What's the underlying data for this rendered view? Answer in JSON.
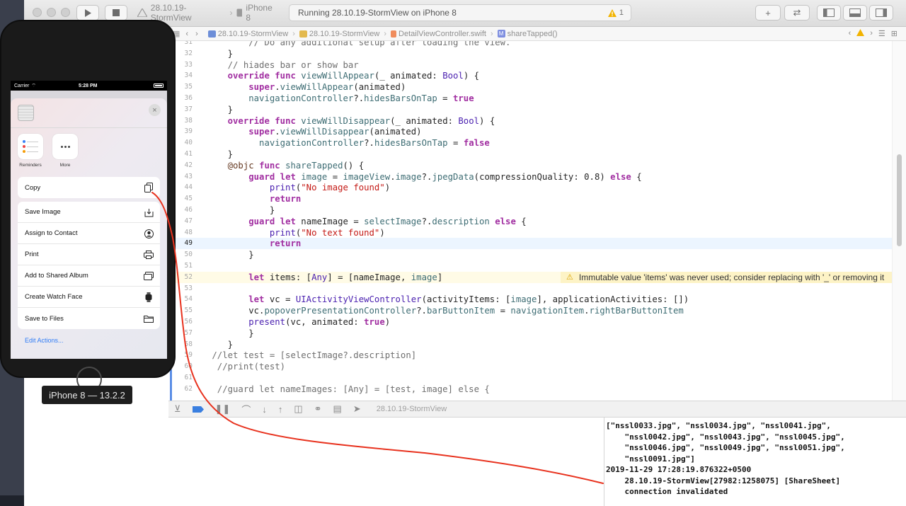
{
  "toolbar": {
    "scheme_name": "28.10.19-StormView",
    "device_name": "iPhone 8",
    "activity_text": "Running 28.10.19-StormView on iPhone 8",
    "warning_count": "1",
    "add_glyph": "+",
    "swap_glyph": "⇄"
  },
  "jumpbar": {
    "crumbs": [
      "28.10.19-StormView",
      "28.10.19-StormView",
      "DetailViewController.swift",
      "shareTapped()"
    ],
    "method_badge": "M"
  },
  "editor": {
    "lines": [
      {
        "n": "31",
        "code": "        // Do any additional setup after loading the view."
      },
      {
        "n": "32",
        "code": "    }"
      },
      {
        "n": "33",
        "code": "    // hiades bar or show bar"
      },
      {
        "n": "34",
        "code": "    override func viewWillAppear(_ animated: Bool) {"
      },
      {
        "n": "35",
        "code": "        super.viewWillAppear(animated)"
      },
      {
        "n": "36",
        "code": "        navigationController?.hidesBarsOnTap = true"
      },
      {
        "n": "37",
        "code": "    }"
      },
      {
        "n": "38",
        "code": "    override func viewWillDisappear(_ animated: Bool) {"
      },
      {
        "n": "39",
        "code": "        super.viewWillDisappear(animated)"
      },
      {
        "n": "40",
        "code": "          navigationController?.hidesBarsOnTap = false"
      },
      {
        "n": "41",
        "code": "    }"
      },
      {
        "n": "42",
        "code": "    @objc func shareTapped() {"
      },
      {
        "n": "43",
        "code": "        guard let image = imageView.image?.jpegData(compressionQuality: 0.8) else {"
      },
      {
        "n": "44",
        "code": "            print(\"No image found\")"
      },
      {
        "n": "45",
        "code": "            return"
      },
      {
        "n": "46",
        "code": "            }"
      },
      {
        "n": "47",
        "code": "        guard let nameImage = selectImage?.description else {"
      },
      {
        "n": "48",
        "code": "            print(\"No text found\")"
      },
      {
        "n": "49",
        "code": "            return"
      },
      {
        "n": "50",
        "code": "        }"
      },
      {
        "n": "51",
        "code": ""
      },
      {
        "n": "52",
        "code": "        let items: [Any] = [nameImage, image]"
      },
      {
        "n": "53",
        "code": ""
      },
      {
        "n": "54",
        "code": "        let vc = UIActivityViewController(activityItems: [image], applicationActivities: [])"
      },
      {
        "n": "55",
        "code": "        vc.popoverPresentationController?.barButtonItem = navigationItem.rightBarButtonItem"
      },
      {
        "n": "56",
        "code": "        present(vc, animated: true)"
      },
      {
        "n": "57",
        "code": "        }"
      },
      {
        "n": "58",
        "code": "    }"
      },
      {
        "n": "59",
        "code": " //let test = [selectImage?.description]"
      },
      {
        "n": "60",
        "code": "  //print(test)"
      },
      {
        "n": "61",
        "code": ""
      },
      {
        "n": "62",
        "code": "  //guard let nameImages: [Any] = [test, image] else {"
      }
    ],
    "current_line": "49",
    "warning_line": "52",
    "warning_message": "Immutable value 'items' was never used; consider replacing with '_' or removing it"
  },
  "debugbar": {
    "target_label": "28.10.19-StormView"
  },
  "console": {
    "lines": [
      "[\"nssl0033.jpg\", \"nssl0034.jpg\", \"nssl0041.jpg\",",
      "    \"nssl0042.jpg\", \"nssl0043.jpg\", \"nssl0045.jpg\",",
      "    \"nssl0046.jpg\", \"nssl0049.jpg\", \"nssl0051.jpg\",",
      "    \"nssl0091.jpg\"]",
      "2019-11-29 17:28:19.876322+0500",
      "    28.10.19-StormView[27982:1258075] [ShareSheet]",
      "    connection invalidated"
    ]
  },
  "simulator": {
    "carrier": "Carrier",
    "time": "5:28 PM",
    "close_glyph": "×",
    "apps": [
      {
        "label": "Reminders",
        "icon": "reminders-icon"
      },
      {
        "label": "More",
        "icon": "more-icon"
      }
    ],
    "copy_action": {
      "label": "Copy",
      "icon": "copy-icon"
    },
    "actions": [
      {
        "label": "Save Image",
        "icon": "save-image-icon"
      },
      {
        "label": "Assign to Contact",
        "icon": "contact-icon"
      },
      {
        "label": "Print",
        "icon": "printer-icon"
      },
      {
        "label": "Add to Shared Album",
        "icon": "shared-album-icon"
      },
      {
        "label": "Create Watch Face",
        "icon": "watch-icon"
      },
      {
        "label": "Save to Files",
        "icon": "folder-icon"
      }
    ],
    "edit_actions": "Edit Actions...",
    "device_label": "iPhone 8 — 13.2.2"
  },
  "colors": {
    "keyword": "#a12ea1",
    "string": "#c41a16",
    "annotation_line": "#e8321e",
    "link_blue": "#2f7cf6",
    "warning_yellow": "#fdf3c6"
  }
}
